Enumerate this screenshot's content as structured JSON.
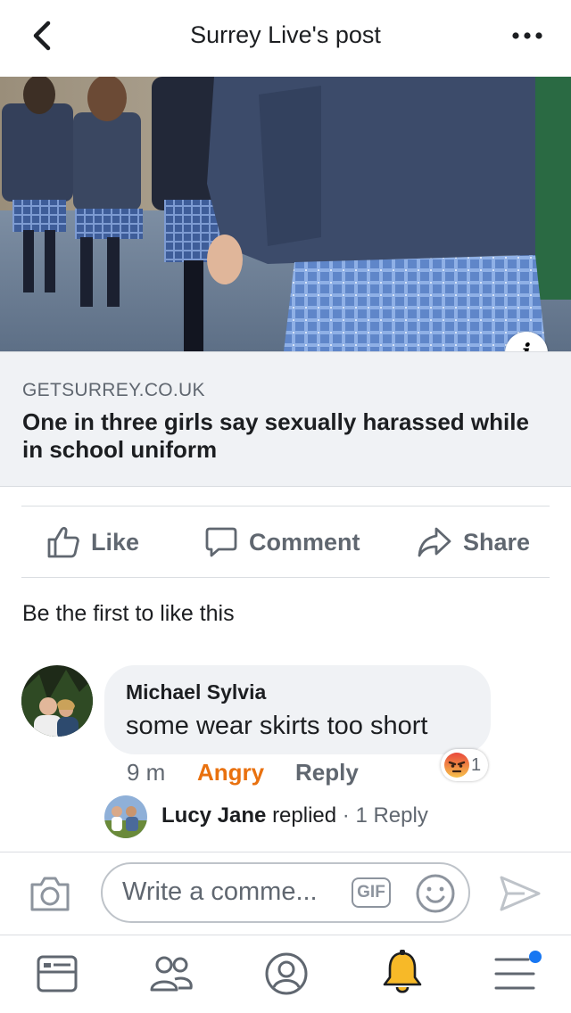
{
  "header": {
    "title": "Surrey Live's post",
    "back_icon": "chevron-left-icon",
    "more_icon": "more-horizontal-icon"
  },
  "post": {
    "image_alt": "school uniform",
    "info_icon": "info-icon",
    "info_glyph": "i",
    "link": {
      "domain": "GETSURREY.CO.UK",
      "title": "One in three girls say sexually harassed while in school uniform"
    }
  },
  "actions": {
    "like": "Like",
    "comment": "Comment",
    "share": "Share"
  },
  "likes_summary": "Be the first to like this",
  "comment": {
    "author": "Michael Sylvia",
    "text": "some wear skirts too short",
    "time": "9 m",
    "reaction_label": "Angry",
    "reply_label": "Reply",
    "reaction_count": "1",
    "reply_preview": {
      "author": "Lucy Jane",
      "verb": "replied",
      "separator": "·",
      "count_label": "1 Reply"
    }
  },
  "composer": {
    "placeholder": "Write a comme...",
    "gif_label": "GIF"
  },
  "colors": {
    "accent_blue": "#1877f2",
    "angry_orange": "#e9710f",
    "notification_yellow": "#f7b928",
    "muted_text": "#606770"
  }
}
